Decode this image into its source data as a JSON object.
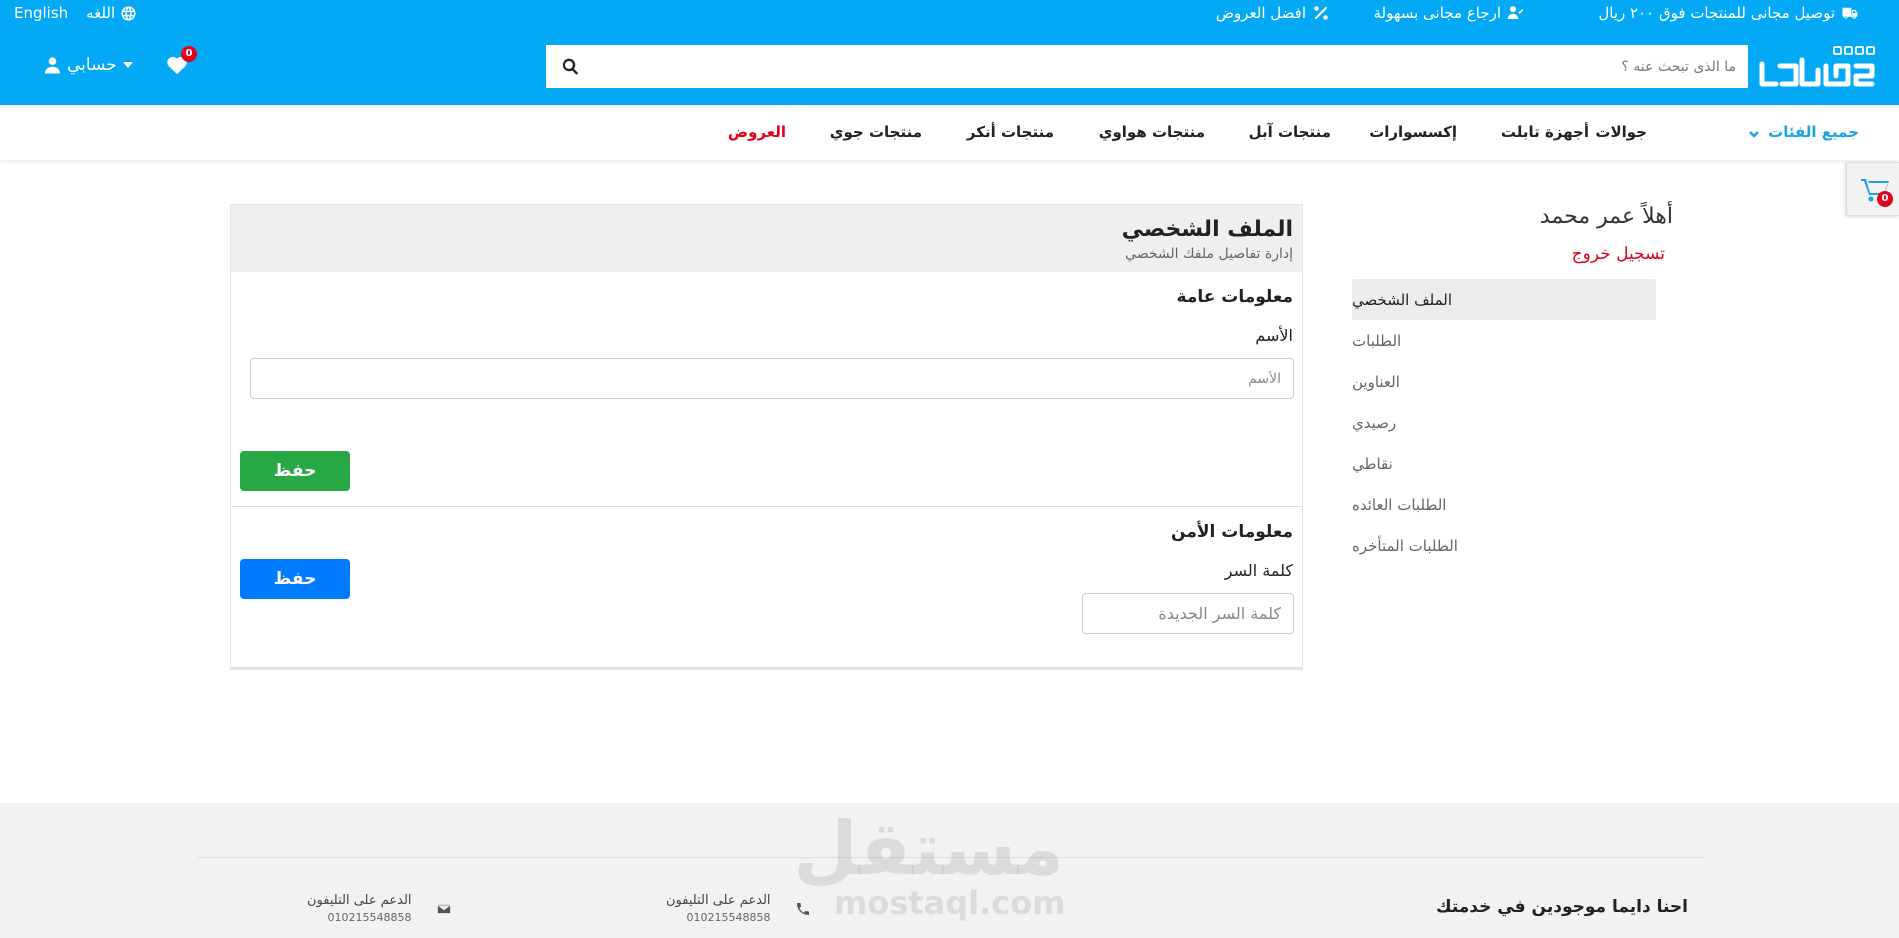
{
  "topbar": {
    "promos": [
      {
        "text": "توصيل مجانى للمنتجات فوق ٢٠٠ ريال",
        "icon": "truck-icon"
      },
      {
        "text": "ارجاع مجانى بسهولة",
        "icon": "user-check-icon"
      },
      {
        "text": "افضل العروض",
        "icon": "percent-icon"
      }
    ],
    "language_label": "اللغه",
    "language_switch": "English"
  },
  "header": {
    "search_placeholder": "ما الذى تبحث عنه ؟",
    "wishlist_count": "0",
    "account_label": "حسابي",
    "brand_color": "#03a9f4"
  },
  "nav": {
    "all_categories": "جميع الفئات",
    "items": [
      "جوالات",
      "أجهزة تابلت",
      "إكسسوارات",
      "منتجات آبل",
      "منتجات هواوي",
      "منتجات أنكر",
      "منتجات جوي"
    ],
    "offers": "العروض"
  },
  "cart": {
    "count": "0"
  },
  "sidebar": {
    "greeting": "أهلاً عمر محمد",
    "logout": "تسجيل خروج",
    "items": [
      "الملف الشخصي",
      "الطلبات",
      "العناوين",
      "رصيدي",
      "نقاطي",
      "الطلبات العائده",
      "الطلبات المتأخره"
    ],
    "active_index": 0
  },
  "profile": {
    "title": "الملف الشخصي",
    "subtitle": "إدارة تفاصيل ملفك الشخصي",
    "general": {
      "title": "معلومات عامة",
      "name_label": "الأسم",
      "name_placeholder": "الأسم",
      "name_value": "",
      "save": "حفظ"
    },
    "security": {
      "title": "معلومات الأمن",
      "password_label": "كلمة السر",
      "password_placeholder": "كلمة السر الجديدة",
      "password_value": "",
      "save": "حفظ"
    }
  },
  "footer": {
    "title": "احنا دايما موجودين في خدمتك",
    "support": [
      {
        "label": "الدعم على التليفون",
        "number": "010215548858",
        "icon": "phone-icon"
      },
      {
        "label": "الدعم على التليفون",
        "number": "010215548858",
        "icon": "envelope-icon"
      }
    ]
  },
  "watermark": {
    "arabic": "مستقل",
    "latin": "mostaql.com"
  }
}
